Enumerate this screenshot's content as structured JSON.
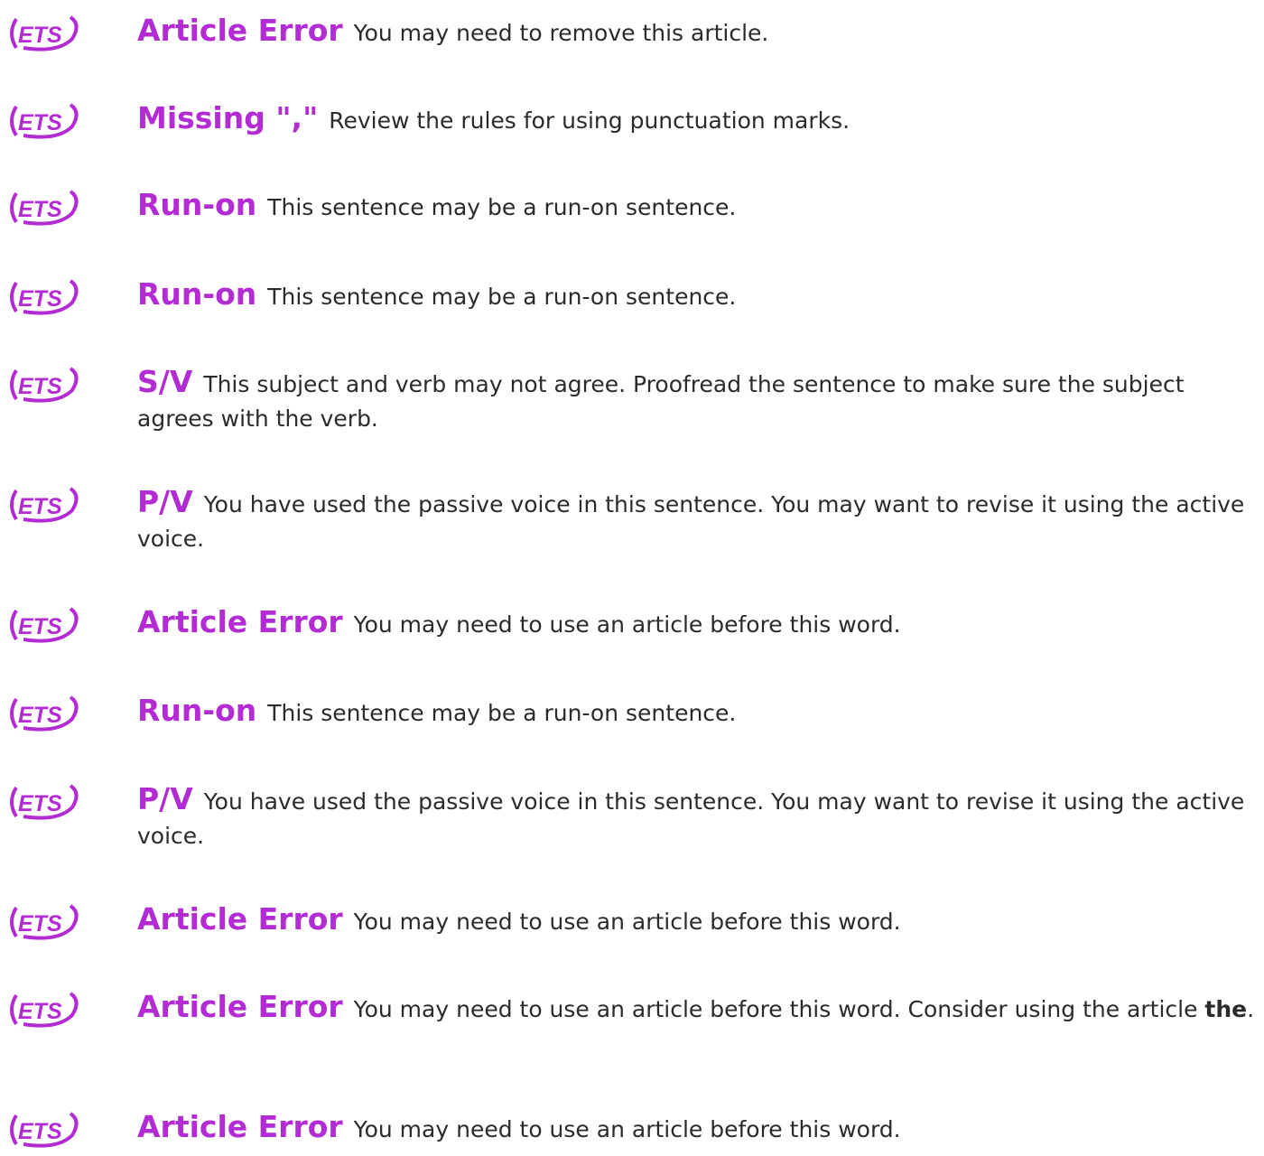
{
  "brand": {
    "logo_text": "ETS",
    "logo_color": "#b22bd3",
    "tag_color": "#b22bd3"
  },
  "items": [
    {
      "icon": "ets-logo-icon",
      "tag": "Article Error",
      "desc": "You may need to remove this article."
    },
    {
      "icon": "ets-logo-icon",
      "tag": "Missing \",\"",
      "desc": "Review the rules for using punctuation marks."
    },
    {
      "icon": "ets-logo-icon",
      "tag": "Run-on",
      "desc": "This sentence may be a run-on sentence."
    },
    {
      "icon": "ets-logo-icon",
      "tag": "Run-on",
      "desc": "This sentence may be a run-on sentence."
    },
    {
      "icon": "ets-logo-icon",
      "tag": "S/V",
      "desc": "This subject and verb may not agree. Proofread the sentence to make sure the subject agrees with the verb."
    },
    {
      "icon": "ets-logo-icon",
      "tag": "P/V",
      "desc": "You have used the passive voice in this sentence. You may want to revise it using the active voice."
    },
    {
      "icon": "ets-logo-icon",
      "tag": "Article Error",
      "desc": "You may need to use an article before this word."
    },
    {
      "icon": "ets-logo-icon",
      "tag": "Run-on",
      "desc": "This sentence may be a run-on sentence."
    },
    {
      "icon": "ets-logo-icon",
      "tag": "P/V",
      "desc": "You have used the passive voice in this sentence. You may want to revise it using the active voice."
    },
    {
      "icon": "ets-logo-icon",
      "tag": "Article Error",
      "desc": "You may need to use an article before this word."
    },
    {
      "icon": "ets-logo-icon",
      "tag": "Article Error",
      "desc": "You may need to use an article before this word. Consider using the article",
      "bold_word": "the",
      "suffix": "."
    },
    {
      "icon": "ets-logo-icon",
      "tag": "Article Error",
      "desc": "You may need to use an article before this word."
    }
  ]
}
